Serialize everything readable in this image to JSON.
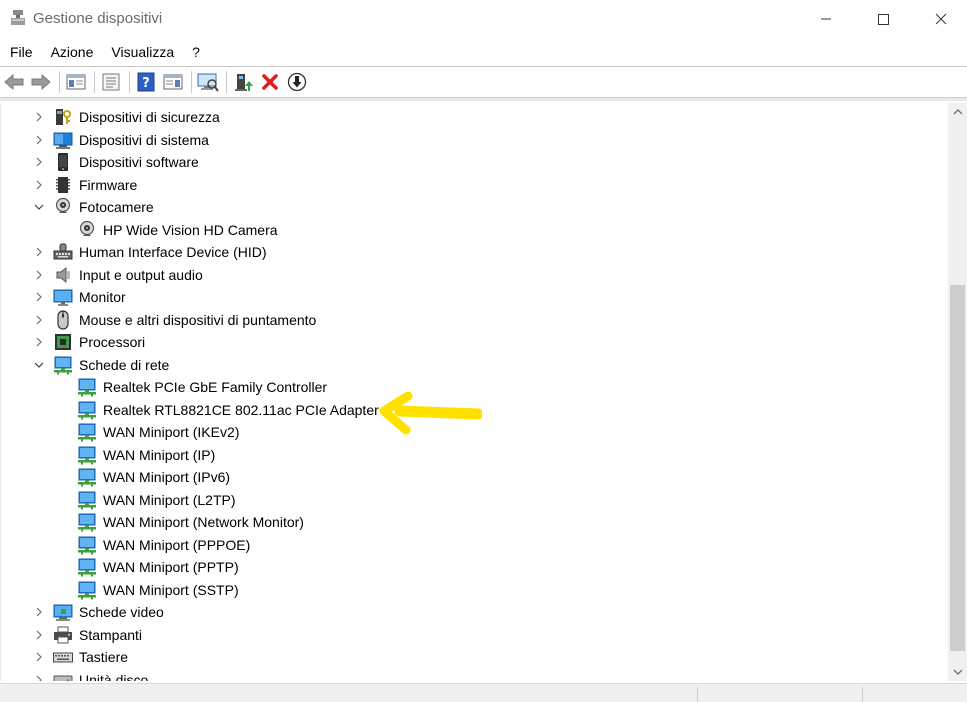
{
  "window": {
    "title": "Gestione dispositivi",
    "controls": [
      "minimize-icon",
      "maximize-icon",
      "close-icon"
    ]
  },
  "menu": [
    "File",
    "Azione",
    "Visualizza",
    "?"
  ],
  "toolbar": {
    "buttons": [
      "back-icon",
      "forward-icon",
      "show-hide-console-tree-icon",
      "properties-icon",
      "help-icon",
      "action-pane-icon",
      "scan-hardware-icon",
      "update-driver-icon",
      "uninstall-icon",
      "disable-device-icon"
    ]
  },
  "tree": [
    {
      "label": "Dispositivi di sicurezza",
      "level": 0,
      "expanded": false,
      "icon": "security-device-icon"
    },
    {
      "label": "Dispositivi di sistema",
      "level": 0,
      "expanded": false,
      "icon": "system-device-icon"
    },
    {
      "label": "Dispositivi software",
      "level": 0,
      "expanded": false,
      "icon": "software-device-icon"
    },
    {
      "label": "Firmware",
      "level": 0,
      "expanded": false,
      "icon": "firmware-icon"
    },
    {
      "label": "Fotocamere",
      "level": 0,
      "expanded": true,
      "icon": "camera-icon"
    },
    {
      "label": "HP Wide Vision HD Camera",
      "level": 1,
      "icon": "camera-icon"
    },
    {
      "label": "Human Interface Device (HID)",
      "level": 0,
      "expanded": false,
      "icon": "hid-icon"
    },
    {
      "label": "Input e output audio",
      "level": 0,
      "expanded": false,
      "icon": "speaker-icon"
    },
    {
      "label": "Monitor",
      "level": 0,
      "expanded": false,
      "icon": "monitor-icon"
    },
    {
      "label": "Mouse e altri dispositivi di puntamento",
      "level": 0,
      "expanded": false,
      "icon": "mouse-icon"
    },
    {
      "label": "Processori",
      "level": 0,
      "expanded": false,
      "icon": "processor-icon"
    },
    {
      "label": "Schede di rete",
      "level": 0,
      "expanded": true,
      "icon": "network-adapter-icon"
    },
    {
      "label": "Realtek PCIe GbE Family Controller",
      "level": 1,
      "icon": "network-adapter-icon"
    },
    {
      "label": "Realtek RTL8821CE 802.11ac PCIe Adapter",
      "level": 1,
      "icon": "network-adapter-icon"
    },
    {
      "label": "WAN Miniport (IKEv2)",
      "level": 1,
      "icon": "network-adapter-icon"
    },
    {
      "label": "WAN Miniport (IP)",
      "level": 1,
      "icon": "network-adapter-icon"
    },
    {
      "label": "WAN Miniport (IPv6)",
      "level": 1,
      "icon": "network-adapter-icon"
    },
    {
      "label": "WAN Miniport (L2TP)",
      "level": 1,
      "icon": "network-adapter-icon"
    },
    {
      "label": "WAN Miniport (Network Monitor)",
      "level": 1,
      "icon": "network-adapter-icon"
    },
    {
      "label": "WAN Miniport (PPPOE)",
      "level": 1,
      "icon": "network-adapter-icon"
    },
    {
      "label": "WAN Miniport (PPTP)",
      "level": 1,
      "icon": "network-adapter-icon"
    },
    {
      "label": "WAN Miniport (SSTP)",
      "level": 1,
      "icon": "network-adapter-icon"
    },
    {
      "label": "Schede video",
      "level": 0,
      "expanded": false,
      "icon": "display-adapter-icon"
    },
    {
      "label": "Stampanti",
      "level": 0,
      "expanded": false,
      "icon": "printer-icon"
    },
    {
      "label": "Tastiere",
      "level": 0,
      "expanded": false,
      "icon": "keyboard-icon"
    },
    {
      "label": "Unità disco",
      "level": 0,
      "expanded": false,
      "icon": "disk-drive-icon"
    }
  ],
  "annotation": {
    "type": "arrow",
    "color": "#ffe100",
    "points_to": "Realtek RTL8821CE 802.11ac PCIe Adapter"
  },
  "colors": {
    "network_blue": "#1e7fd8",
    "network_green": "#3ea13b",
    "uninstall_red": "#e01b1b",
    "help_blue": "#2d5fc7",
    "scroll_thumb": "#cdcdcd"
  }
}
